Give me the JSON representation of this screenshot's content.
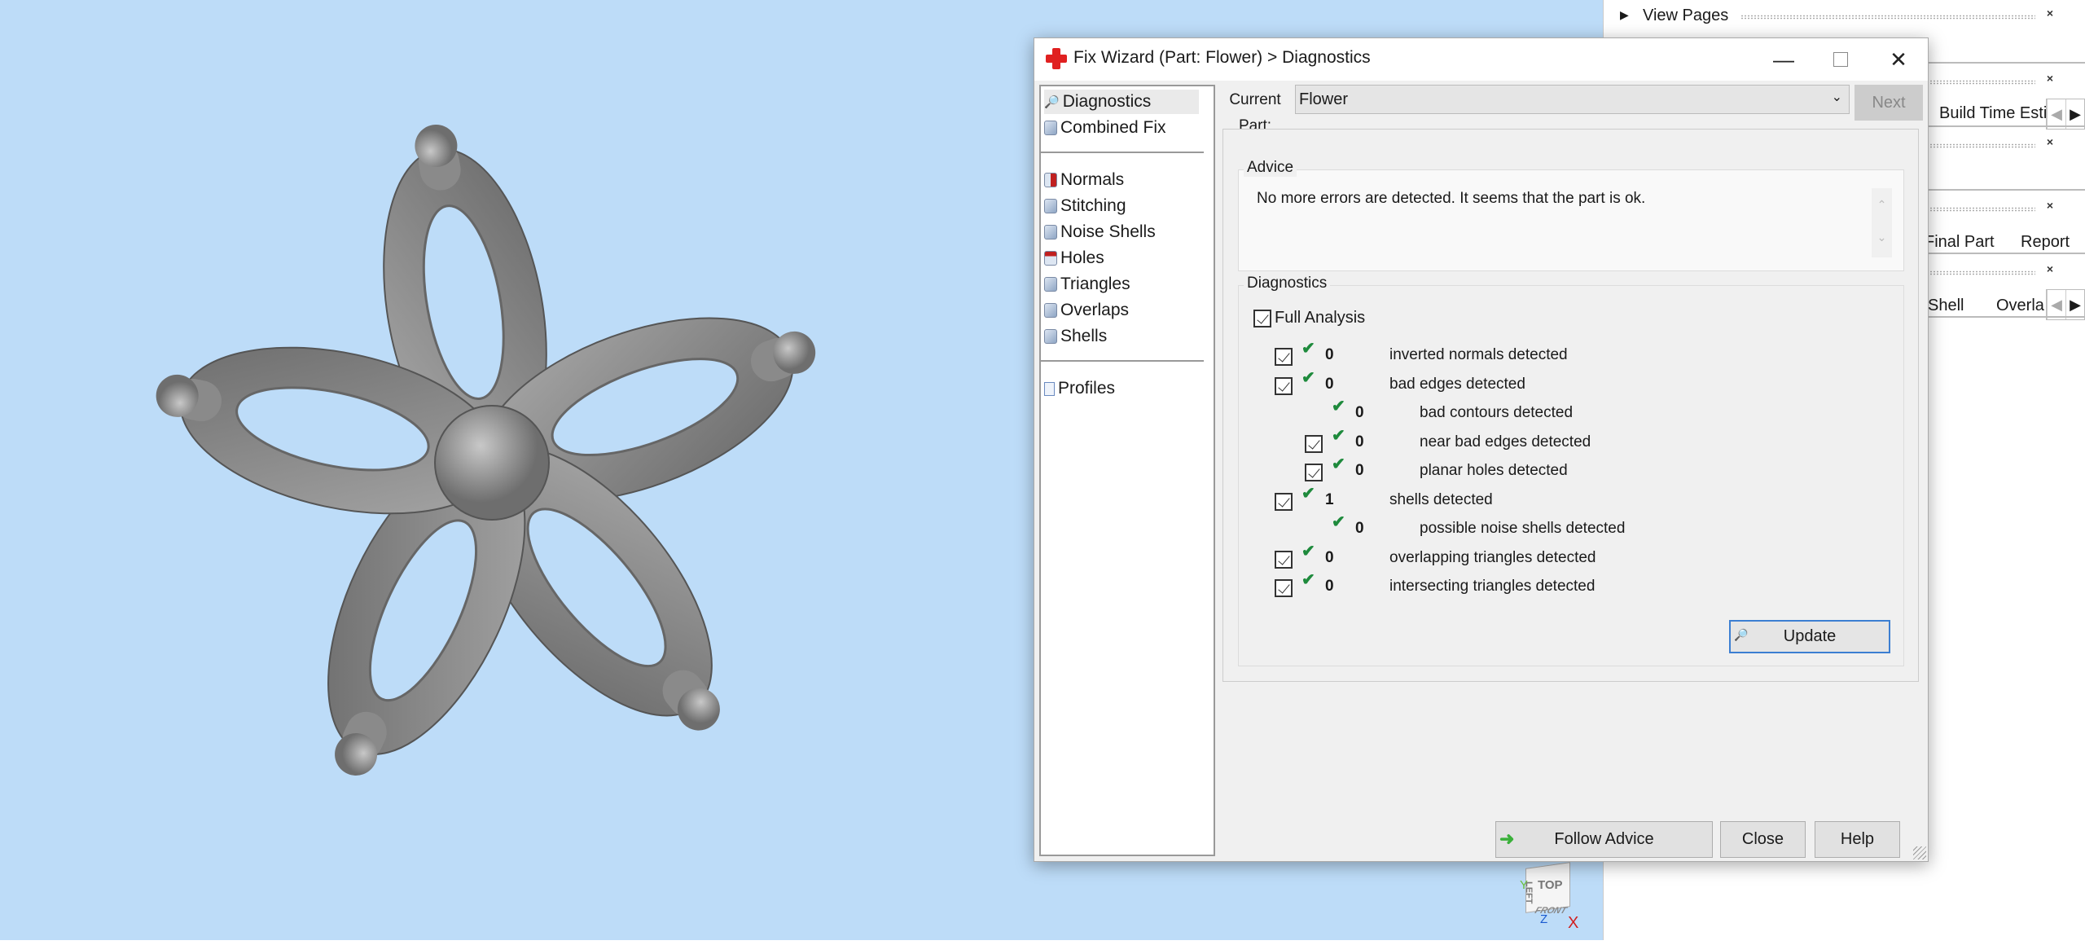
{
  "dialog": {
    "title": "Fix Wizard (Part: Flower) > Diagnostics",
    "window_controls": [
      "minimize",
      "maximize",
      "close"
    ],
    "nav": [
      {
        "label": "Diagnostics",
        "icon": "magnifier-icon",
        "selected": true
      },
      {
        "label": "Combined Fix",
        "icon": "cube-icon"
      },
      {
        "label": "Normals",
        "icon": "normals-cube-icon"
      },
      {
        "label": "Stitching",
        "icon": "stitching-cube-icon"
      },
      {
        "label": "Noise Shells",
        "icon": "noise-shells-icon"
      },
      {
        "label": "Holes",
        "icon": "holes-cube-icon"
      },
      {
        "label": "Triangles",
        "icon": "triangles-icon"
      },
      {
        "label": "Overlaps",
        "icon": "overlaps-icon"
      },
      {
        "label": "Shells",
        "icon": "shells-icon"
      },
      {
        "label": "Profiles",
        "icon": "document-icon"
      }
    ],
    "current_part_label": "Current Part:",
    "current_part_value": "Flower",
    "next_label": "Next",
    "advice_title": "Advice",
    "advice_text": "No more errors are detected. It seems that the part is ok.",
    "diagnostics_title": "Diagnostics",
    "full_analysis_label": "Full Analysis",
    "full_analysis_checked": true,
    "rows": [
      {
        "checkbox": true,
        "level": 0,
        "count": "0",
        "label": "inverted normals detected",
        "ok": true
      },
      {
        "checkbox": true,
        "level": 0,
        "count": "0",
        "label": "bad edges detected",
        "ok": true
      },
      {
        "checkbox": false,
        "level": 1,
        "count": "0",
        "label": "bad contours detected",
        "ok": true
      },
      {
        "checkbox": true,
        "level": 1,
        "count": "0",
        "label": "near bad edges detected",
        "ok": true
      },
      {
        "checkbox": true,
        "level": 1,
        "count": "0",
        "label": "planar holes detected",
        "ok": true
      },
      {
        "checkbox": true,
        "level": 0,
        "count": "1",
        "label": "shells detected",
        "ok": true
      },
      {
        "checkbox": false,
        "level": 1,
        "count": "0",
        "label": "possible noise shells detected",
        "ok": true
      },
      {
        "checkbox": true,
        "level": 0,
        "count": "0",
        "label": "overlapping triangles detected",
        "ok": true
      },
      {
        "checkbox": true,
        "level": 0,
        "count": "0",
        "label": "intersecting triangles detected",
        "ok": true
      }
    ],
    "update_label": "Update",
    "follow_advice_label": "Follow Advice",
    "close_label": "Close",
    "help_label": "Help"
  },
  "right_panel": {
    "view_pages": "View Pages",
    "tabs1": [
      "Build Time Esti"
    ],
    "tabs2": [
      "Final Part",
      "Report"
    ],
    "tabs3": [
      "Shell",
      "Overla"
    ]
  },
  "viewcube": {
    "face_top": "TOP",
    "face_front": "FRONT",
    "face_left": "LEFT",
    "axis_x": "X",
    "axis_y": "Y",
    "axis_z": "Z"
  },
  "colors": {
    "viewport_bg": "#bddcf8",
    "check_green": "#1e8a3c",
    "wizard_red": "#e02020",
    "part_gray": "#8c8c8c"
  }
}
